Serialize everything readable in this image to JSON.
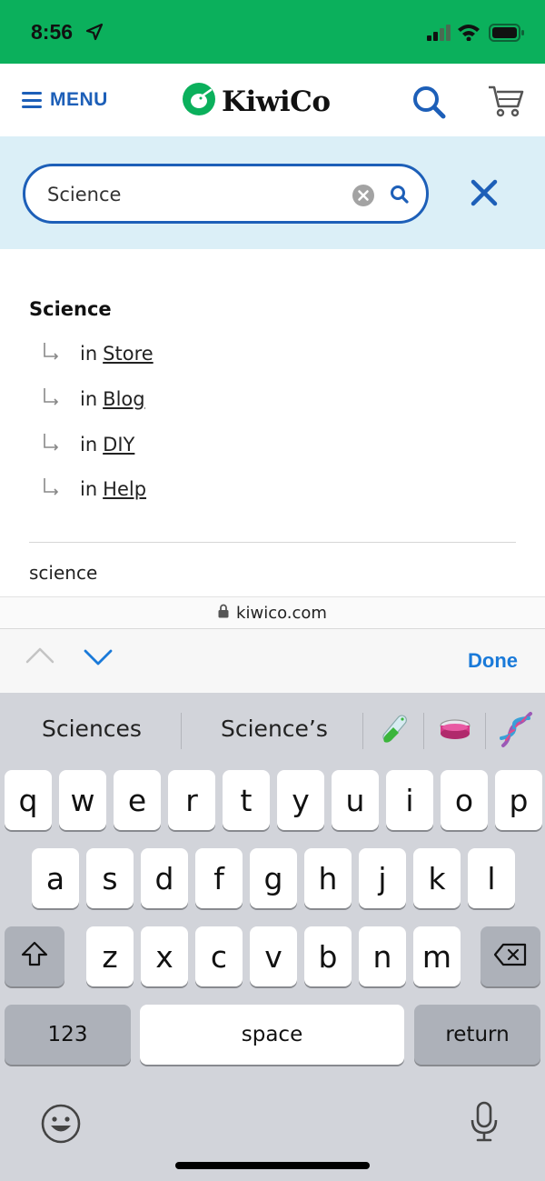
{
  "status_bar": {
    "time": "8:56",
    "icons": [
      "location-arrow-icon",
      "cellular-signal-icon",
      "wifi-icon",
      "battery-icon"
    ]
  },
  "header": {
    "menu_label": "MENU",
    "logo_text": "KiwiCo",
    "icons": [
      "menu-icon",
      "kiwi-logo-icon",
      "search-icon",
      "cart-icon"
    ]
  },
  "search": {
    "value": "Science",
    "icons": [
      "clear-icon",
      "search-icon",
      "close-icon"
    ]
  },
  "results": {
    "heading": "Science",
    "items": [
      {
        "prefix": "in",
        "link": "Store"
      },
      {
        "prefix": "in",
        "link": "Blog"
      },
      {
        "prefix": "in",
        "link": "DIY"
      },
      {
        "prefix": "in",
        "link": "Help"
      }
    ],
    "suggestion": "science"
  },
  "browser": {
    "url": "kiwico.com"
  },
  "accessory": {
    "done_label": "Done"
  },
  "keyboard": {
    "predictions": [
      "Sciences",
      "Science’s"
    ],
    "emoji_suggestions": [
      "test-tube-icon",
      "petri-dish-icon",
      "dna-icon"
    ],
    "row1": [
      "q",
      "w",
      "e",
      "r",
      "t",
      "y",
      "u",
      "i",
      "o",
      "p"
    ],
    "row2": [
      "a",
      "s",
      "d",
      "f",
      "g",
      "h",
      "j",
      "k",
      "l"
    ],
    "row3": [
      "z",
      "x",
      "c",
      "v",
      "b",
      "n",
      "m"
    ],
    "numbers_label": "123",
    "space_label": "space",
    "return_label": "return"
  },
  "colors": {
    "status_bar": "#0bb05c",
    "brand_blue": "#1d5fb8",
    "search_panel": "#dbeff7",
    "done_blue": "#1a7ad9",
    "keyboard_bg": "#d2d4da"
  }
}
